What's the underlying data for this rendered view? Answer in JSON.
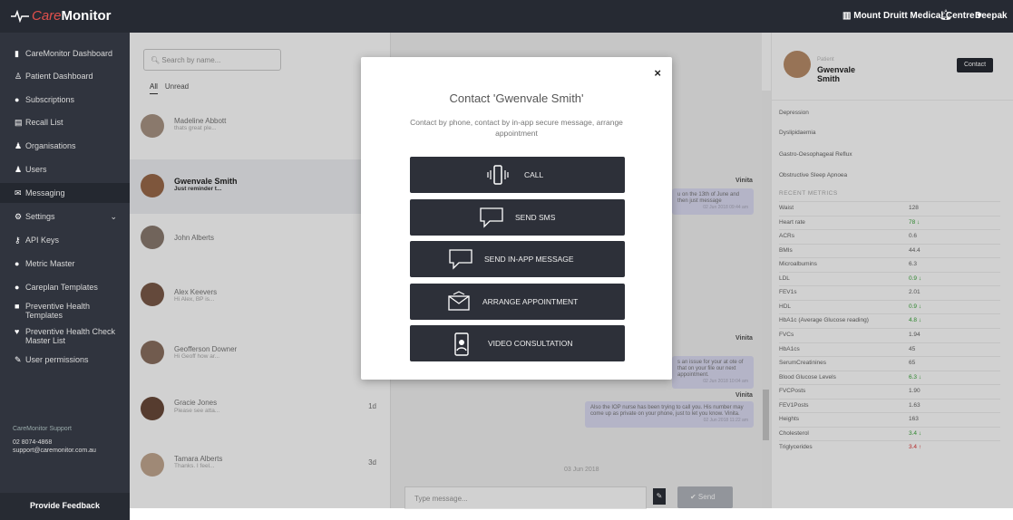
{
  "app": {
    "brand_part1": "Care",
    "brand_part2": "Monitor",
    "centre": "Mount Druitt Medical Centre",
    "user": "Deepak"
  },
  "sidebar": {
    "items": [
      {
        "icon": "▮",
        "label": "CareMonitor Dashboard"
      },
      {
        "icon": "♙",
        "label": "Patient Dashboard"
      },
      {
        "icon": "●",
        "label": "Subscriptions"
      },
      {
        "icon": "▤",
        "label": "Recall List"
      },
      {
        "icon": "♟",
        "label": "Organisations"
      },
      {
        "icon": "♟",
        "label": "Users"
      },
      {
        "icon": "✉",
        "label": "Messaging"
      },
      {
        "icon": "⚙",
        "label": "Settings"
      },
      {
        "icon": "⚷",
        "label": "API Keys"
      },
      {
        "icon": "●",
        "label": "Metric Master"
      },
      {
        "icon": "●",
        "label": "Careplan Templates"
      },
      {
        "icon": "■",
        "label": "Preventive Health Templates"
      },
      {
        "icon": "♥",
        "label": "Preventive Health Check Master List"
      },
      {
        "icon": "✎",
        "label": "User permissions"
      }
    ],
    "support_title": "CareMonitor Support",
    "support_phone": "02 8074-4868",
    "support_email": "support@caremonitor.com.au",
    "feedback": "Provide Feedback"
  },
  "conversations": {
    "search_placeholder": "Search by name...",
    "tabs": [
      "All",
      "Unread"
    ],
    "items": [
      {
        "name": "Madeline Abbott",
        "preview": "thats great ple...",
        "time": ""
      },
      {
        "name": "Gwenvale Smith",
        "preview": "Just reminder t...",
        "time": ""
      },
      {
        "name": "John Alberts",
        "preview": "",
        "time": ""
      },
      {
        "name": "Alex Keevers",
        "preview": "Hi Alex, BP is...",
        "time": ""
      },
      {
        "name": "Geofferson Downer",
        "preview": "Hi Geoff how ar...",
        "time": ""
      },
      {
        "name": "Gracie Jones",
        "preview": "Please see atta...",
        "time": "1d"
      },
      {
        "name": "Tamara Alberts",
        "preview": "Thanks. I feel...",
        "time": "3d"
      }
    ]
  },
  "chat": {
    "sender1": "Vinita",
    "bubble1": "u on the 13th of June and then just message",
    "bubble1_time": "02 Jun 2018 09:44 am",
    "sender2": "Vinita",
    "bubble2": "s an issue for your at ote of that on your file our next appointment.",
    "bubble2_time": "02 Jun 2018 10:04 am",
    "sender3": "Vinita",
    "bubble3": "Also the IOP nurse has been trying to call you. His number may come up as private on your phone, just to let you know. Vinita.",
    "bubble3_time": "02 Jun 2018 11:22 am",
    "date_separator": "03 Jun 2018",
    "input_placeholder": "Type message...",
    "send_label": "✔  Send"
  },
  "patient": {
    "label": "Patient",
    "name": "Gwenvale Smith",
    "contact_label": "Contact",
    "conditions": [
      "Depression",
      "Dyslipidaemia",
      "Gastro-Oesophageal Reflux",
      "Obstructive Sleep Apnoea"
    ],
    "recent_title": "RECENT METRICS",
    "metrics": [
      {
        "name": "Waist",
        "value": "128",
        "trend": ""
      },
      {
        "name": "Heart rate",
        "value": "78 ↓",
        "trend": "g"
      },
      {
        "name": "ACRs",
        "value": "0.6",
        "trend": ""
      },
      {
        "name": "BMIs",
        "value": "44.4",
        "trend": ""
      },
      {
        "name": "Microalbumins",
        "value": "6.3",
        "trend": ""
      },
      {
        "name": "LDL",
        "value": "0.9 ↓",
        "trend": "g"
      },
      {
        "name": "FEV1s",
        "value": "2.01",
        "trend": ""
      },
      {
        "name": "HDL",
        "value": "0.9 ↓",
        "trend": "g"
      },
      {
        "name": "HbA1c (Average Glucose reading)",
        "value": "4.8 ↓",
        "trend": "g"
      },
      {
        "name": "FVCs",
        "value": "1.94",
        "trend": ""
      },
      {
        "name": "HbA1cs",
        "value": "45",
        "trend": ""
      },
      {
        "name": "SerumCreatinines",
        "value": "65",
        "trend": ""
      },
      {
        "name": "Blood Glucose Levels",
        "value": "6.3 ↓",
        "trend": "g"
      },
      {
        "name": "FVCPosts",
        "value": "1.90",
        "trend": ""
      },
      {
        "name": "FEV1Posts",
        "value": "1.63",
        "trend": ""
      },
      {
        "name": "Heights",
        "value": "163",
        "trend": ""
      },
      {
        "name": "Cholesterol",
        "value": "3.4 ↓",
        "trend": "g"
      },
      {
        "name": "Triglycerides",
        "value": "3.4 ↑",
        "trend": "r"
      }
    ]
  },
  "modal": {
    "title": "Contact 'Gwenvale Smith'",
    "subtitle": "Contact by phone, contact by in-app secure message, arrange appointment",
    "close": "×",
    "buttons": [
      {
        "label": "CALL",
        "icon": "📳"
      },
      {
        "label": "SEND SMS",
        "icon": "💬"
      },
      {
        "label": "SEND IN-APP MESSAGE",
        "icon": "💬"
      },
      {
        "label": "ARRANGE APPOINTMENT",
        "icon": "✉"
      },
      {
        "label": "VIDEO CONSULTATION",
        "icon": "📱"
      }
    ]
  }
}
